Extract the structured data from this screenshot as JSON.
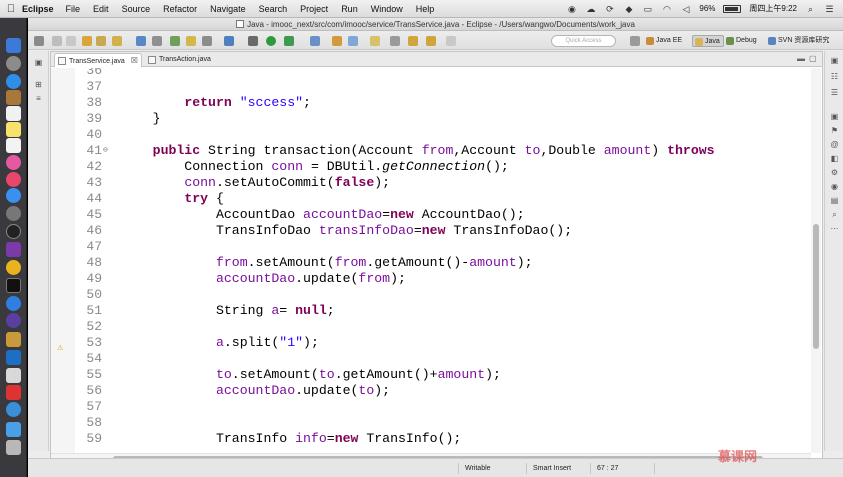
{
  "menubar": {
    "apple": "",
    "app": "Eclipse",
    "items": [
      "File",
      "Edit",
      "Source",
      "Refactor",
      "Navigate",
      "Search",
      "Project",
      "Run",
      "Window",
      "Help"
    ],
    "battery": "96%",
    "clock": "周四上午9:22"
  },
  "window": {
    "title": "Java - imooc_next/src/com/imooc/service/TransService.java - Eclipse - /Users/wangwo/Documents/work_java"
  },
  "toolbar": {
    "quick_access": "Quick Access",
    "perspectives": [
      "Java EE",
      "Java",
      "Debug",
      "SVN 资源库研究"
    ]
  },
  "tabs": [
    {
      "label": "TransService.java",
      "close": "☒",
      "active": true
    },
    {
      "label": "TransAction.java",
      "close": "",
      "active": false
    }
  ],
  "tab_controls": {
    "minimize": "▬",
    "maximize": "▢"
  },
  "editor": {
    "line_numbers": [
      "36",
      "37",
      "38",
      "39",
      "40",
      "41",
      "42",
      "43",
      "44",
      "45",
      "46",
      "47",
      "48",
      "49",
      "50",
      "51",
      "52",
      "53",
      "54",
      "55",
      "56",
      "57",
      "58",
      "59"
    ],
    "fold_marker": "⊖",
    "warning_marker": "⚠"
  },
  "status": {
    "writable": "Writable",
    "insert_mode": "Smart Insert",
    "position": "67 : 27"
  },
  "watermark": "慕课网"
}
